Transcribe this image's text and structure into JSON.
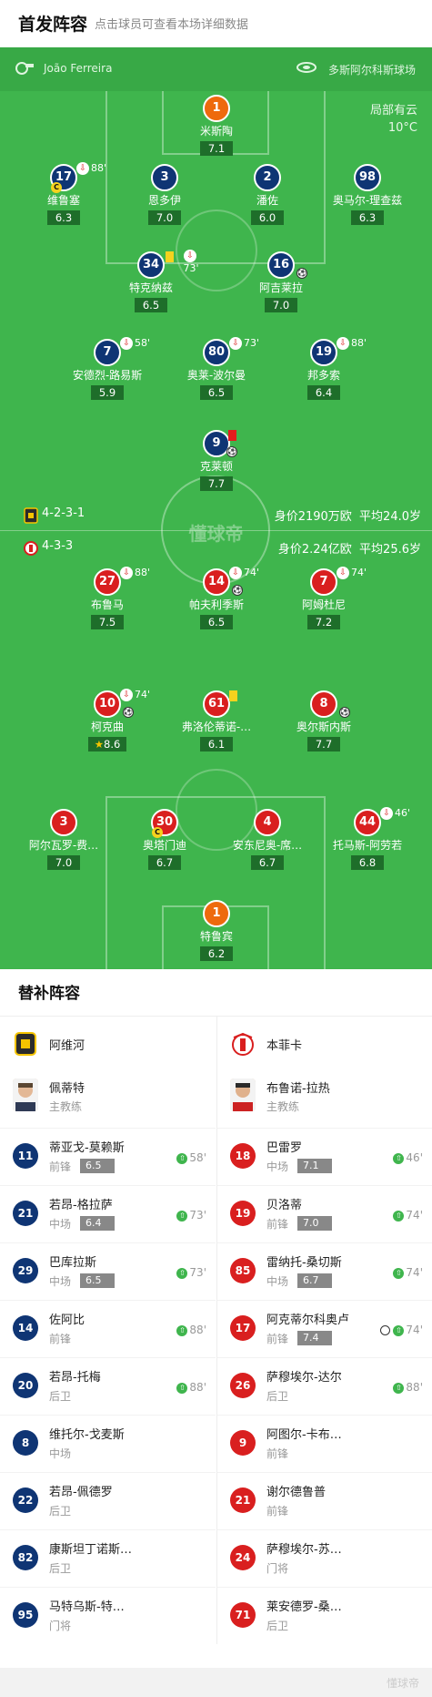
{
  "header": {
    "title": "首发阵容",
    "subtitle": "点击球员可查看本场详细数据"
  },
  "match": {
    "referee": "João Ferreira",
    "venue": "多斯阿尔科斯球场",
    "weather": "局部有云",
    "temperature": "10°C"
  },
  "home": {
    "formation": "4-2-3-1",
    "value": "身价2190万欧",
    "age": "平均24.0岁"
  },
  "away": {
    "formation": "4-3-3",
    "value": "身价2.24亿欧",
    "age": "平均25.6岁"
  },
  "watermark": "懂球帝",
  "home_players": [
    {
      "num": "1",
      "name": "米斯陶",
      "rating": "7.1"
    },
    {
      "num": "17",
      "name": "维鲁塞",
      "rating": "6.3",
      "sub_min": "88'"
    },
    {
      "num": "3",
      "name": "恩多伊",
      "rating": "7.0"
    },
    {
      "num": "2",
      "name": "潘佐",
      "rating": "6.0"
    },
    {
      "num": "98",
      "name": "奥马尔-理查兹",
      "rating": "6.3"
    },
    {
      "num": "34",
      "name": "特克纳兹",
      "rating": "6.5",
      "sub_min": "73'"
    },
    {
      "num": "16",
      "name": "阿吉莱拉",
      "rating": "7.0"
    },
    {
      "num": "7",
      "name": "安德烈-路易斯",
      "rating": "5.9",
      "sub_min": "58'"
    },
    {
      "num": "80",
      "name": "奥莱-波尔曼",
      "rating": "6.5",
      "sub_min": "73'"
    },
    {
      "num": "19",
      "name": "邦多索",
      "rating": "6.4",
      "sub_min": "88'"
    },
    {
      "num": "9",
      "name": "克莱顿",
      "rating": "7.7"
    }
  ],
  "away_players": [
    {
      "num": "27",
      "name": "布鲁马",
      "rating": "7.5",
      "sub_min": "88'"
    },
    {
      "num": "14",
      "name": "帕夫利季斯",
      "rating": "6.5",
      "sub_min": "74'"
    },
    {
      "num": "7",
      "name": "阿姆杜尼",
      "rating": "7.2",
      "sub_min": "74'"
    },
    {
      "num": "10",
      "name": "柯克曲",
      "rating": "8.6",
      "sub_min": "74'"
    },
    {
      "num": "61",
      "name": "弗洛伦蒂诺-…",
      "rating": "6.1"
    },
    {
      "num": "8",
      "name": "奥尔斯内斯",
      "rating": "7.7"
    },
    {
      "num": "3",
      "name": "阿尔瓦罗-费…",
      "rating": "7.0"
    },
    {
      "num": "30",
      "name": "奥塔门迪",
      "rating": "6.7"
    },
    {
      "num": "4",
      "name": "安东尼奥-席…",
      "rating": "6.7"
    },
    {
      "num": "44",
      "name": "托马斯-阿劳若",
      "rating": "6.8",
      "sub_min": "46'"
    },
    {
      "num": "1",
      "name": "特鲁宾",
      "rating": "6.2"
    }
  ],
  "subs": {
    "title": "替补阵容",
    "left": {
      "team": "阿维河",
      "coach": "佩蒂特",
      "coach_role": "主教练",
      "players": [
        {
          "num": "11",
          "name": "蒂亚戈-莫赖斯",
          "pos": "前锋",
          "rating": "6.5",
          "in": "58'"
        },
        {
          "num": "21",
          "name": "若昂-格拉萨",
          "pos": "中场",
          "rating": "6.4",
          "in": "73'"
        },
        {
          "num": "29",
          "name": "巴库拉斯",
          "pos": "中场",
          "rating": "6.5",
          "in": "73'"
        },
        {
          "num": "14",
          "name": "佐阿比",
          "pos": "前锋",
          "in": "88'"
        },
        {
          "num": "20",
          "name": "若昂-托梅",
          "pos": "后卫",
          "in": "88'"
        },
        {
          "num": "8",
          "name": "维托尔-戈麦斯",
          "pos": "中场"
        },
        {
          "num": "22",
          "name": "若昂-佩德罗",
          "pos": "后卫"
        },
        {
          "num": "82",
          "name": "康斯坦丁诺斯…",
          "pos": "后卫"
        },
        {
          "num": "95",
          "name": "马特乌斯-特…",
          "pos": "门将"
        }
      ]
    },
    "right": {
      "team": "本菲卡",
      "coach": "布鲁诺-拉热",
      "coach_role": "主教练",
      "players": [
        {
          "num": "18",
          "name": "巴雷罗",
          "pos": "中场",
          "rating": "7.1",
          "in": "46'"
        },
        {
          "num": "19",
          "name": "贝洛蒂",
          "pos": "前锋",
          "rating": "7.0",
          "in": "74'"
        },
        {
          "num": "85",
          "name": "雷纳托-桑切斯",
          "pos": "中场",
          "rating": "6.7",
          "in": "74'"
        },
        {
          "num": "17",
          "name": "阿克蒂尔科奥卢",
          "pos": "前锋",
          "rating": "7.4",
          "in": "74'"
        },
        {
          "num": "26",
          "name": "萨穆埃尔-达尔",
          "pos": "后卫",
          "in": "88'"
        },
        {
          "num": "9",
          "name": "阿图尔-卡布…",
          "pos": "前锋"
        },
        {
          "num": "21",
          "name": "谢尔德鲁普",
          "pos": "前锋"
        },
        {
          "num": "24",
          "name": "萨穆埃尔-苏…",
          "pos": "门将"
        },
        {
          "num": "71",
          "name": "莱安德罗-桑…",
          "pos": "后卫"
        }
      ]
    }
  },
  "footer": {
    "watermark": "懂球帝"
  }
}
